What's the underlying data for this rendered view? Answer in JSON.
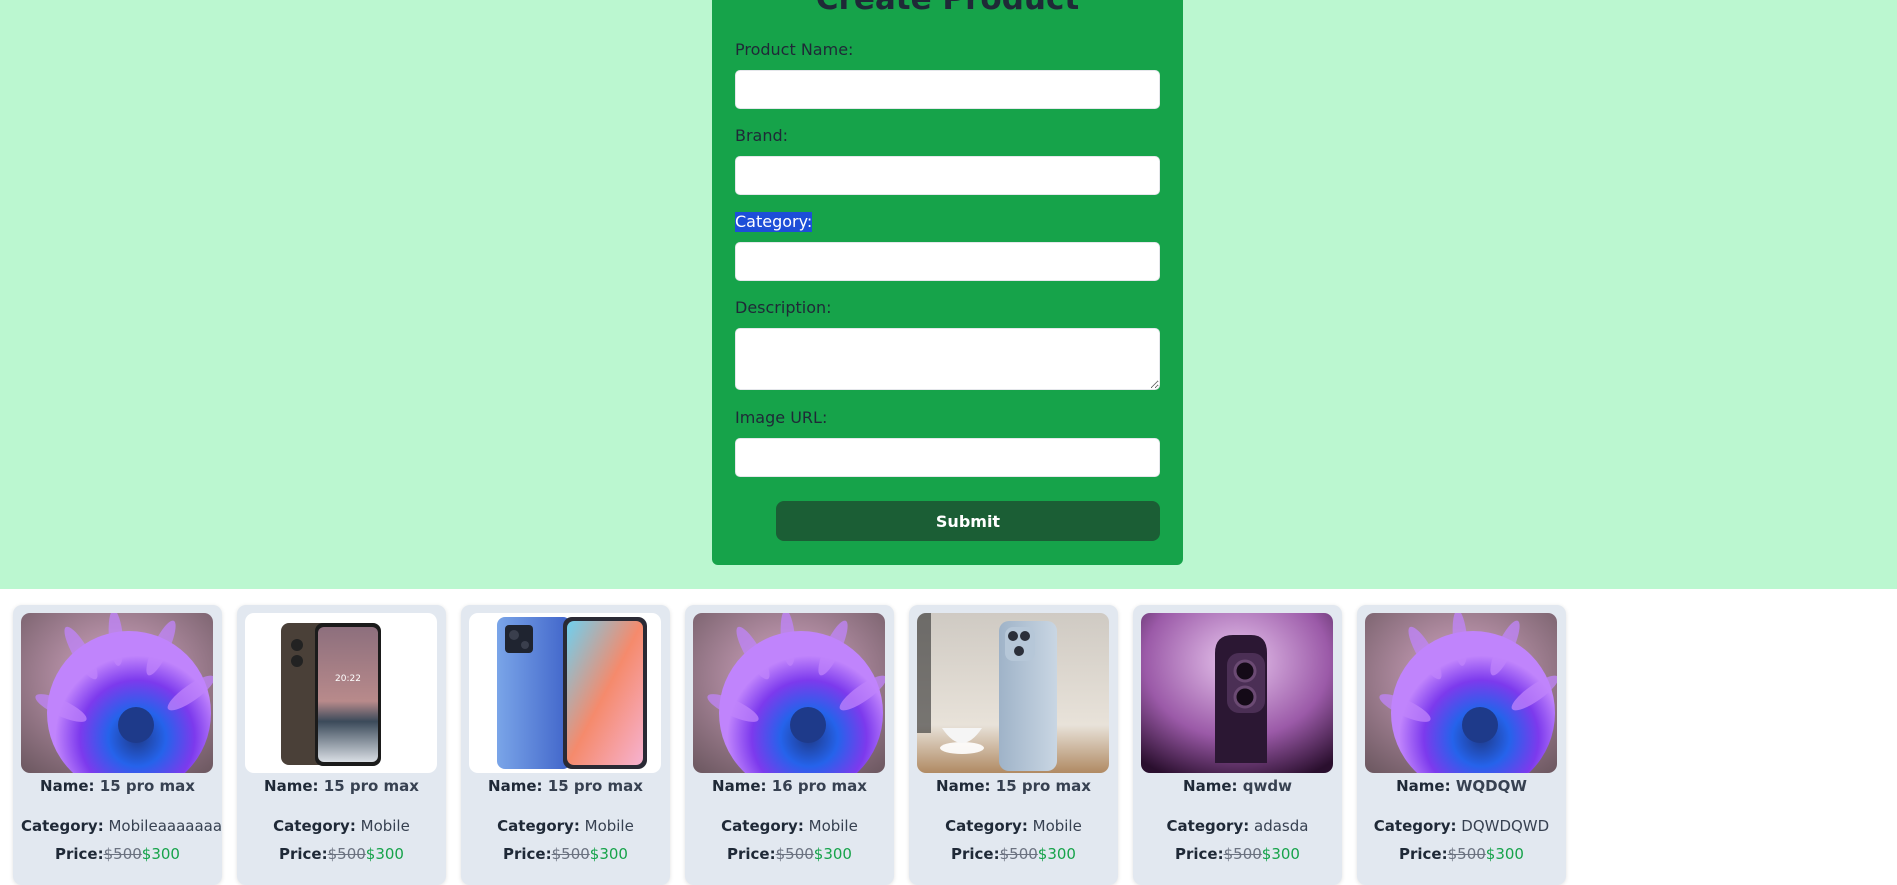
{
  "form": {
    "title": "Create Product",
    "fields": [
      {
        "label": "Product Name:",
        "value": ""
      },
      {
        "label": "Brand:",
        "value": ""
      },
      {
        "label": "Category:",
        "value": ""
      },
      {
        "label": "Description:",
        "value": ""
      },
      {
        "label": "Image URL:",
        "value": ""
      }
    ],
    "submit_label": "Submit"
  },
  "products": [
    {
      "name_key": "Name:",
      "name": "15 pro max",
      "category_key": "Category:",
      "category": "Mobileaaaaaaa",
      "price_key": "Price:",
      "old_price": "$500",
      "new_price": "$300",
      "image": "purple-flower-photo"
    },
    {
      "name_key": "Name:",
      "name": "15 pro max",
      "category_key": "Category:",
      "category": "Mobile",
      "price_key": "Price:",
      "old_price": "$500",
      "new_price": "$300",
      "image": "dark-smartphone-photo"
    },
    {
      "name_key": "Name:",
      "name": "15 pro max",
      "category_key": "Category:",
      "category": "Mobile",
      "price_key": "Price:",
      "old_price": "$500",
      "new_price": "$300",
      "image": "blue-smartphone-photo"
    },
    {
      "name_key": "Name:",
      "name": "16 pro max",
      "category_key": "Category:",
      "category": "Mobile",
      "price_key": "Price:",
      "old_price": "$500",
      "new_price": "$300",
      "image": "purple-flower-photo"
    },
    {
      "name_key": "Name:",
      "name": "15 pro max",
      "category_key": "Category:",
      "category": "Mobile",
      "price_key": "Price:",
      "old_price": "$500",
      "new_price": "$300",
      "image": "blue-iphone-photo"
    },
    {
      "name_key": "Name:",
      "name": "qwdw",
      "category_key": "Category:",
      "category": "adasda",
      "price_key": "Price:",
      "old_price": "$500",
      "new_price": "$300",
      "image": "purple-iphone-photo"
    },
    {
      "name_key": "Name:",
      "name": "WQDQW",
      "category_key": "Category:",
      "category": "DQWDQWD",
      "price_key": "Price:",
      "old_price": "$500",
      "new_price": "$300",
      "image": "purple-flower-photo"
    }
  ],
  "colors": {
    "page_top_bg": "#bbf7d0",
    "form_bg": "#16a34a",
    "submit_bg": "#1b5e35",
    "card_bg": "#e2e8f0",
    "sale_price": "#16a34a"
  }
}
